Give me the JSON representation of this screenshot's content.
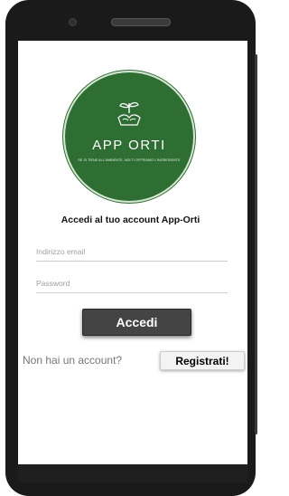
{
  "logo": {
    "title": "APP ORTI",
    "tagline": "SE SI TIENE ALL'AMBIENTE, NOI TI OFFRIAMO L'INGREDIENTE",
    "icon": "plant-hands-icon",
    "background_color": "#2e6e33"
  },
  "login": {
    "heading": "Accedi al  tuo account App-Orti",
    "email_placeholder": "Indirizzo email",
    "password_placeholder": "Password",
    "submit_label": "Accedi"
  },
  "signup": {
    "prompt": "Non hai un account?",
    "button_label": "Registrati!"
  }
}
